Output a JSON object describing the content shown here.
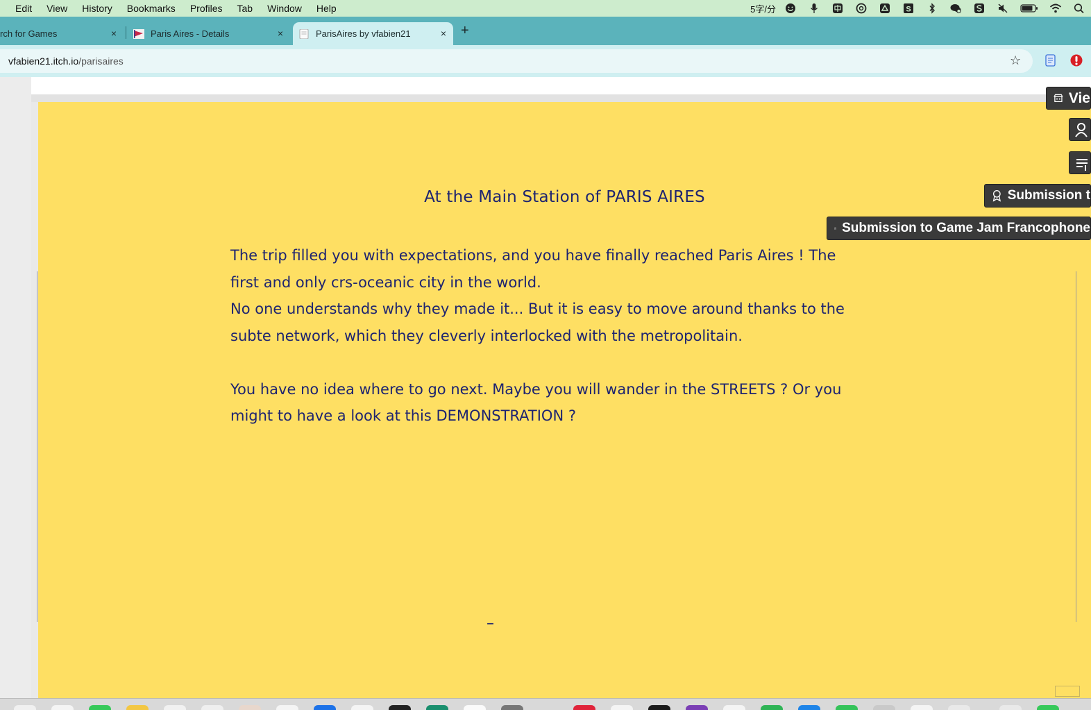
{
  "menubar": {
    "items": [
      "Edit",
      "View",
      "History",
      "Bookmarks",
      "Profiles",
      "Tab",
      "Window",
      "Help"
    ],
    "status_text": "5字/分",
    "status_icons": [
      "smiley-icon",
      "microphone-icon",
      "input-method-icon",
      "chatgpt-icon",
      "drive-icon",
      "s-app-icon",
      "bluetooth-icon",
      "wechat-icon",
      "s-sync-icon",
      "mute-icon",
      "battery-icon",
      "wifi-icon",
      "spotlight-search-icon"
    ]
  },
  "tabs": [
    {
      "title": "rch for Games",
      "close": "×"
    },
    {
      "title": "Paris Aires - Details",
      "close": "×"
    },
    {
      "title": "ParisAires by vfabien21",
      "close": "×"
    }
  ],
  "new_tab": "+",
  "address": {
    "host": "vfabien21.itch.io",
    "path": "/parisaires"
  },
  "game": {
    "title": "At the Main Station of PARIS AIRES",
    "paragraph1_line1": "The trip filled you with expectations, and you have finally reached Paris Aires ! The",
    "paragraph1_line2": "first and only crs-oceanic city in the world.",
    "paragraph2_line1": "No one understands why they made it... But it is easy to move around thanks to the",
    "paragraph2_line2": "subte network, which they cleverly interlocked with the metropolitain.",
    "paragraph3_line1": "You have no idea where to go next. Maybe you will wander in the STREETS ? Or you",
    "paragraph3_line2": "might to have a look at this DEMONSTRATION ?",
    "cursor": "–"
  },
  "badges": {
    "view": "Vie",
    "submission_short": "Submission t",
    "submission_full": "Submission to Game Jam Francophone"
  },
  "colors": {
    "game_background": "#fedf63",
    "game_text": "#1e2470",
    "tabstrip": "#5bb3bb",
    "toolbar": "#cfeff1",
    "menubar": "#cdeccd"
  }
}
